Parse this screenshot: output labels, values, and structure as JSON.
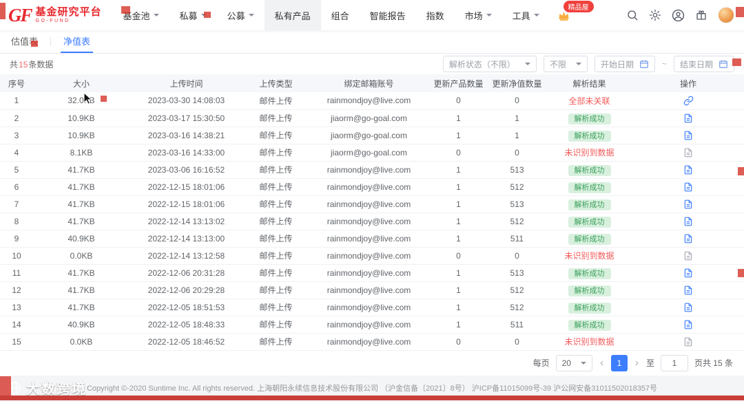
{
  "header": {
    "logo": {
      "gf": "GF",
      "title": "基金研究平台",
      "subtitle": "GO-FUND"
    },
    "nav": [
      {
        "label": "基金池",
        "dropdown": true
      },
      {
        "label": "私募",
        "dropdown": true
      },
      {
        "label": "公募",
        "dropdown": true
      },
      {
        "label": "私有产品",
        "dropdown": false,
        "active": true
      },
      {
        "label": "组合",
        "dropdown": false
      },
      {
        "label": "智能报告",
        "dropdown": false
      },
      {
        "label": "指数",
        "dropdown": false
      },
      {
        "label": "市场",
        "dropdown": true
      },
      {
        "label": "工具",
        "dropdown": true
      }
    ],
    "premium_badge": "精品屋"
  },
  "tabs": [
    {
      "label": "估值表"
    },
    {
      "label": "净值表"
    }
  ],
  "filters": {
    "total_prefix": "共",
    "total_count": "15",
    "total_suffix": "条数据",
    "parse_status_value": "解析状态（不限）",
    "scope_value": "不限",
    "start_date_placeholder": "开始日期",
    "date_separator": "~",
    "end_date_placeholder": "结束日期"
  },
  "table": {
    "columns": [
      "序号",
      "大小",
      "上传时间",
      "上传类型",
      "绑定邮箱账号",
      "更新产品数量",
      "更新净值数量",
      "解析结果",
      "操作"
    ],
    "rows": [
      {
        "no": "1",
        "size": "32.0KB",
        "time": "2023-03-30 14:08:03",
        "type": "邮件上传",
        "email": "rainmondjoy@live.com",
        "products": "0",
        "navs": "0",
        "result": "全部未关联",
        "result_type": "error",
        "action": "link"
      },
      {
        "no": "2",
        "size": "10.9KB",
        "time": "2023-03-17 15:30:50",
        "type": "邮件上传",
        "email": "jiaorm@go-goal.com",
        "products": "1",
        "navs": "1",
        "result": "解析成功",
        "result_type": "success",
        "action": "detail"
      },
      {
        "no": "3",
        "size": "10.9KB",
        "time": "2023-03-16 14:38:21",
        "type": "邮件上传",
        "email": "jiaorm@go-goal.com",
        "products": "1",
        "navs": "1",
        "result": "解析成功",
        "result_type": "success",
        "action": "detail"
      },
      {
        "no": "4",
        "size": "8.1KB",
        "time": "2023-03-16 14:33:00",
        "type": "邮件上传",
        "email": "jiaorm@go-goal.com",
        "products": "0",
        "navs": "0",
        "result": "未识别到数据",
        "result_type": "warn",
        "action": "file"
      },
      {
        "no": "5",
        "size": "41.7KB",
        "time": "2023-03-06 16:16:52",
        "type": "邮件上传",
        "email": "rainmondjoy@live.com",
        "products": "1",
        "navs": "513",
        "result": "解析成功",
        "result_type": "success",
        "action": "detail"
      },
      {
        "no": "6",
        "size": "41.7KB",
        "time": "2022-12-15 18:01:06",
        "type": "邮件上传",
        "email": "rainmondjoy@live.com",
        "products": "1",
        "navs": "512",
        "result": "解析成功",
        "result_type": "success",
        "action": "detail"
      },
      {
        "no": "7",
        "size": "41.7KB",
        "time": "2022-12-15 18:01:06",
        "type": "邮件上传",
        "email": "rainmondjoy@live.com",
        "products": "1",
        "navs": "513",
        "result": "解析成功",
        "result_type": "success",
        "action": "detail"
      },
      {
        "no": "8",
        "size": "41.7KB",
        "time": "2022-12-14 13:13:02",
        "type": "邮件上传",
        "email": "rainmondjoy@live.com",
        "products": "1",
        "navs": "512",
        "result": "解析成功",
        "result_type": "success",
        "action": "detail"
      },
      {
        "no": "9",
        "size": "40.9KB",
        "time": "2022-12-14 13:13:00",
        "type": "邮件上传",
        "email": "rainmondjoy@live.com",
        "products": "1",
        "navs": "511",
        "result": "解析成功",
        "result_type": "success",
        "action": "detail"
      },
      {
        "no": "10",
        "size": "0.0KB",
        "time": "2022-12-14 13:12:58",
        "type": "邮件上传",
        "email": "rainmondjoy@live.com",
        "products": "0",
        "navs": "0",
        "result": "未识别到数据",
        "result_type": "warn",
        "action": "file"
      },
      {
        "no": "11",
        "size": "41.7KB",
        "time": "2022-12-06 20:31:28",
        "type": "邮件上传",
        "email": "rainmondjoy@live.com",
        "products": "1",
        "navs": "513",
        "result": "解析成功",
        "result_type": "success",
        "action": "detail"
      },
      {
        "no": "12",
        "size": "41.7KB",
        "time": "2022-12-06 20:29:28",
        "type": "邮件上传",
        "email": "rainmondjoy@live.com",
        "products": "1",
        "navs": "512",
        "result": "解析成功",
        "result_type": "success",
        "action": "detail"
      },
      {
        "no": "13",
        "size": "41.7KB",
        "time": "2022-12-05 18:51:53",
        "type": "邮件上传",
        "email": "rainmondjoy@live.com",
        "products": "1",
        "navs": "512",
        "result": "解析成功",
        "result_type": "success",
        "action": "detail"
      },
      {
        "no": "14",
        "size": "40.9KB",
        "time": "2022-12-05 18:48:33",
        "type": "邮件上传",
        "email": "rainmondjoy@live.com",
        "products": "1",
        "navs": "511",
        "result": "解析成功",
        "result_type": "success",
        "action": "detail"
      },
      {
        "no": "15",
        "size": "0.0KB",
        "time": "2022-12-05 18:46:52",
        "type": "邮件上传",
        "email": "rainmondjoy@live.com",
        "products": "0",
        "navs": "0",
        "result": "未识别到数据",
        "result_type": "warn",
        "action": "file"
      }
    ]
  },
  "pagination": {
    "per_page_label": "每页",
    "page_size": "20",
    "prev": "‹",
    "current": "1",
    "next": "›",
    "jump_label": "至",
    "jump_value": "1",
    "total_label": "页共 15 条"
  },
  "footer": {
    "copyright": "Copyright ©-2020 Suntime Inc. All rights reserved. 上海朝阳永续信息技术股份有限公司 （沪金信备〔2021〕8号）  沪ICP备11015099号-39  沪公网安备31011502018357号"
  },
  "watermark": {
    "text": "大数跨境"
  },
  "colors": {
    "brand_red": "#e8292f",
    "accent_blue": "#3d7eff",
    "success_green": "#3ba05a",
    "danger_red": "#f25a5a"
  }
}
